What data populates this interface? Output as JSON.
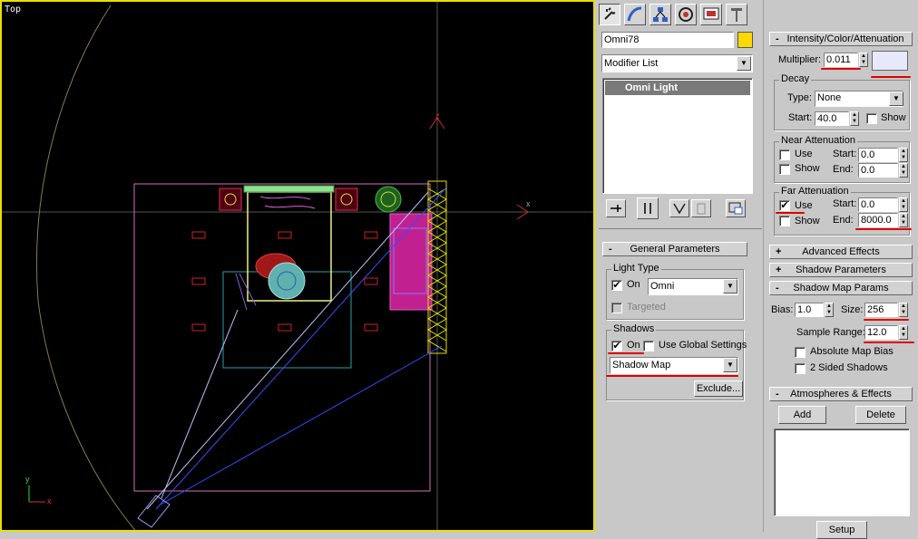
{
  "viewport": {
    "label": "Top",
    "axis_x": "x",
    "axis_y": "y",
    "axis_z": "z"
  },
  "command_panel": {
    "tabs": [
      "create-icon",
      "modify-icon",
      "hierarchy-icon",
      "motion-icon",
      "display-icon",
      "utilities-icon"
    ],
    "object_name": "Omni78",
    "object_color": "#ffd800",
    "modifier_list_label": "Modifier List",
    "stack_items": [
      "Omni Light"
    ]
  },
  "general_parameters": {
    "title": "General Parameters",
    "light_type_title": "Light Type",
    "on_label": "On",
    "on_checked": true,
    "light_type_value": "Omni",
    "targeted_label": "Targeted",
    "shadows_title": "Shadows",
    "shadows_on_label": "On",
    "shadows_on_checked": true,
    "use_global_label": "Use Global Settings",
    "shadow_type_value": "Shadow Map",
    "exclude_label": "Exclude..."
  },
  "intensity": {
    "title": "Intensity/Color/Attenuation",
    "multiplier_label": "Multiplier:",
    "multiplier_value": "0.011",
    "light_color": "#e8e8fc",
    "decay_title": "Decay",
    "type_label": "Type:",
    "type_value": "None",
    "start_label": "Start:",
    "decay_start_value": "40.0",
    "show_label": "Show",
    "near_title": "Near Attenuation",
    "use_label": "Use",
    "end_label": "End:",
    "near_start_value": "0.0",
    "near_end_value": "0.0",
    "far_title": "Far Attenuation",
    "far_use_checked": true,
    "far_start_value": "0.0",
    "far_end_value": "8000.0"
  },
  "rollouts": {
    "advanced_effects": "Advanced Effects",
    "shadow_parameters": "Shadow Parameters",
    "shadow_map_params": "Shadow Map Params",
    "atmospheres": "Atmospheres & Effects"
  },
  "shadow_map": {
    "bias_label": "Bias:",
    "bias_value": "1.0",
    "size_label": "Size:",
    "size_value": "256",
    "sample_range_label": "Sample Range:",
    "sample_range_value": "12.0",
    "absolute_label": "Absolute Map Bias",
    "two_sided_label": "2 Sided Shadows"
  },
  "atmospheres": {
    "add_label": "Add",
    "delete_label": "Delete",
    "setup_label": "Setup"
  }
}
